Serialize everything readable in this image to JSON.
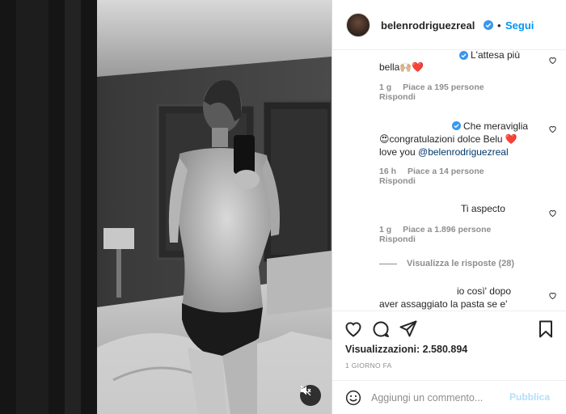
{
  "header": {
    "username": "belenrodriguezreal",
    "separator": "•",
    "follow_label": "Segui"
  },
  "comments": [
    {
      "text_line1": "L'attesa più",
      "text_line2": "bella🙌🏼❤️",
      "time": "1 g",
      "likes": "Piace a 195 persone",
      "reply": "Rispondi"
    },
    {
      "text_line1": "Che meraviglia",
      "text_line2": "😍congratulazioni dolce Belu ❤️",
      "text_line3_prefix": "love you ",
      "text_line3_mention": "@belenrodriguezreal",
      "time": "16 h",
      "likes": "Piace a 14 persone",
      "reply": "Rispondi"
    },
    {
      "text_line1": "Ti aspecto",
      "time": "1 g",
      "likes": "Piace a 1.896 persone",
      "reply": "Rispondi",
      "view_replies": "Visualizza le risposte (28)"
    },
    {
      "text_line1": "io così' dopo",
      "text_line2": "aver assaggiato la pasta se e'"
    }
  ],
  "actions": {
    "icons": [
      "heart-icon",
      "comment-icon",
      "share-icon",
      "bookmark-icon"
    ],
    "views": "Visualizzazioni: 2.580.894",
    "posted_ago": "1 GIORNO FA"
  },
  "add_comment": {
    "placeholder": "Aggiungi un commento...",
    "post_label": "Pubblica"
  },
  "colors": {
    "link_blue": "#0095f6",
    "verified_blue": "#3897f0",
    "muted_text": "#8e8e8e",
    "post_disabled": "#b2dffc"
  }
}
